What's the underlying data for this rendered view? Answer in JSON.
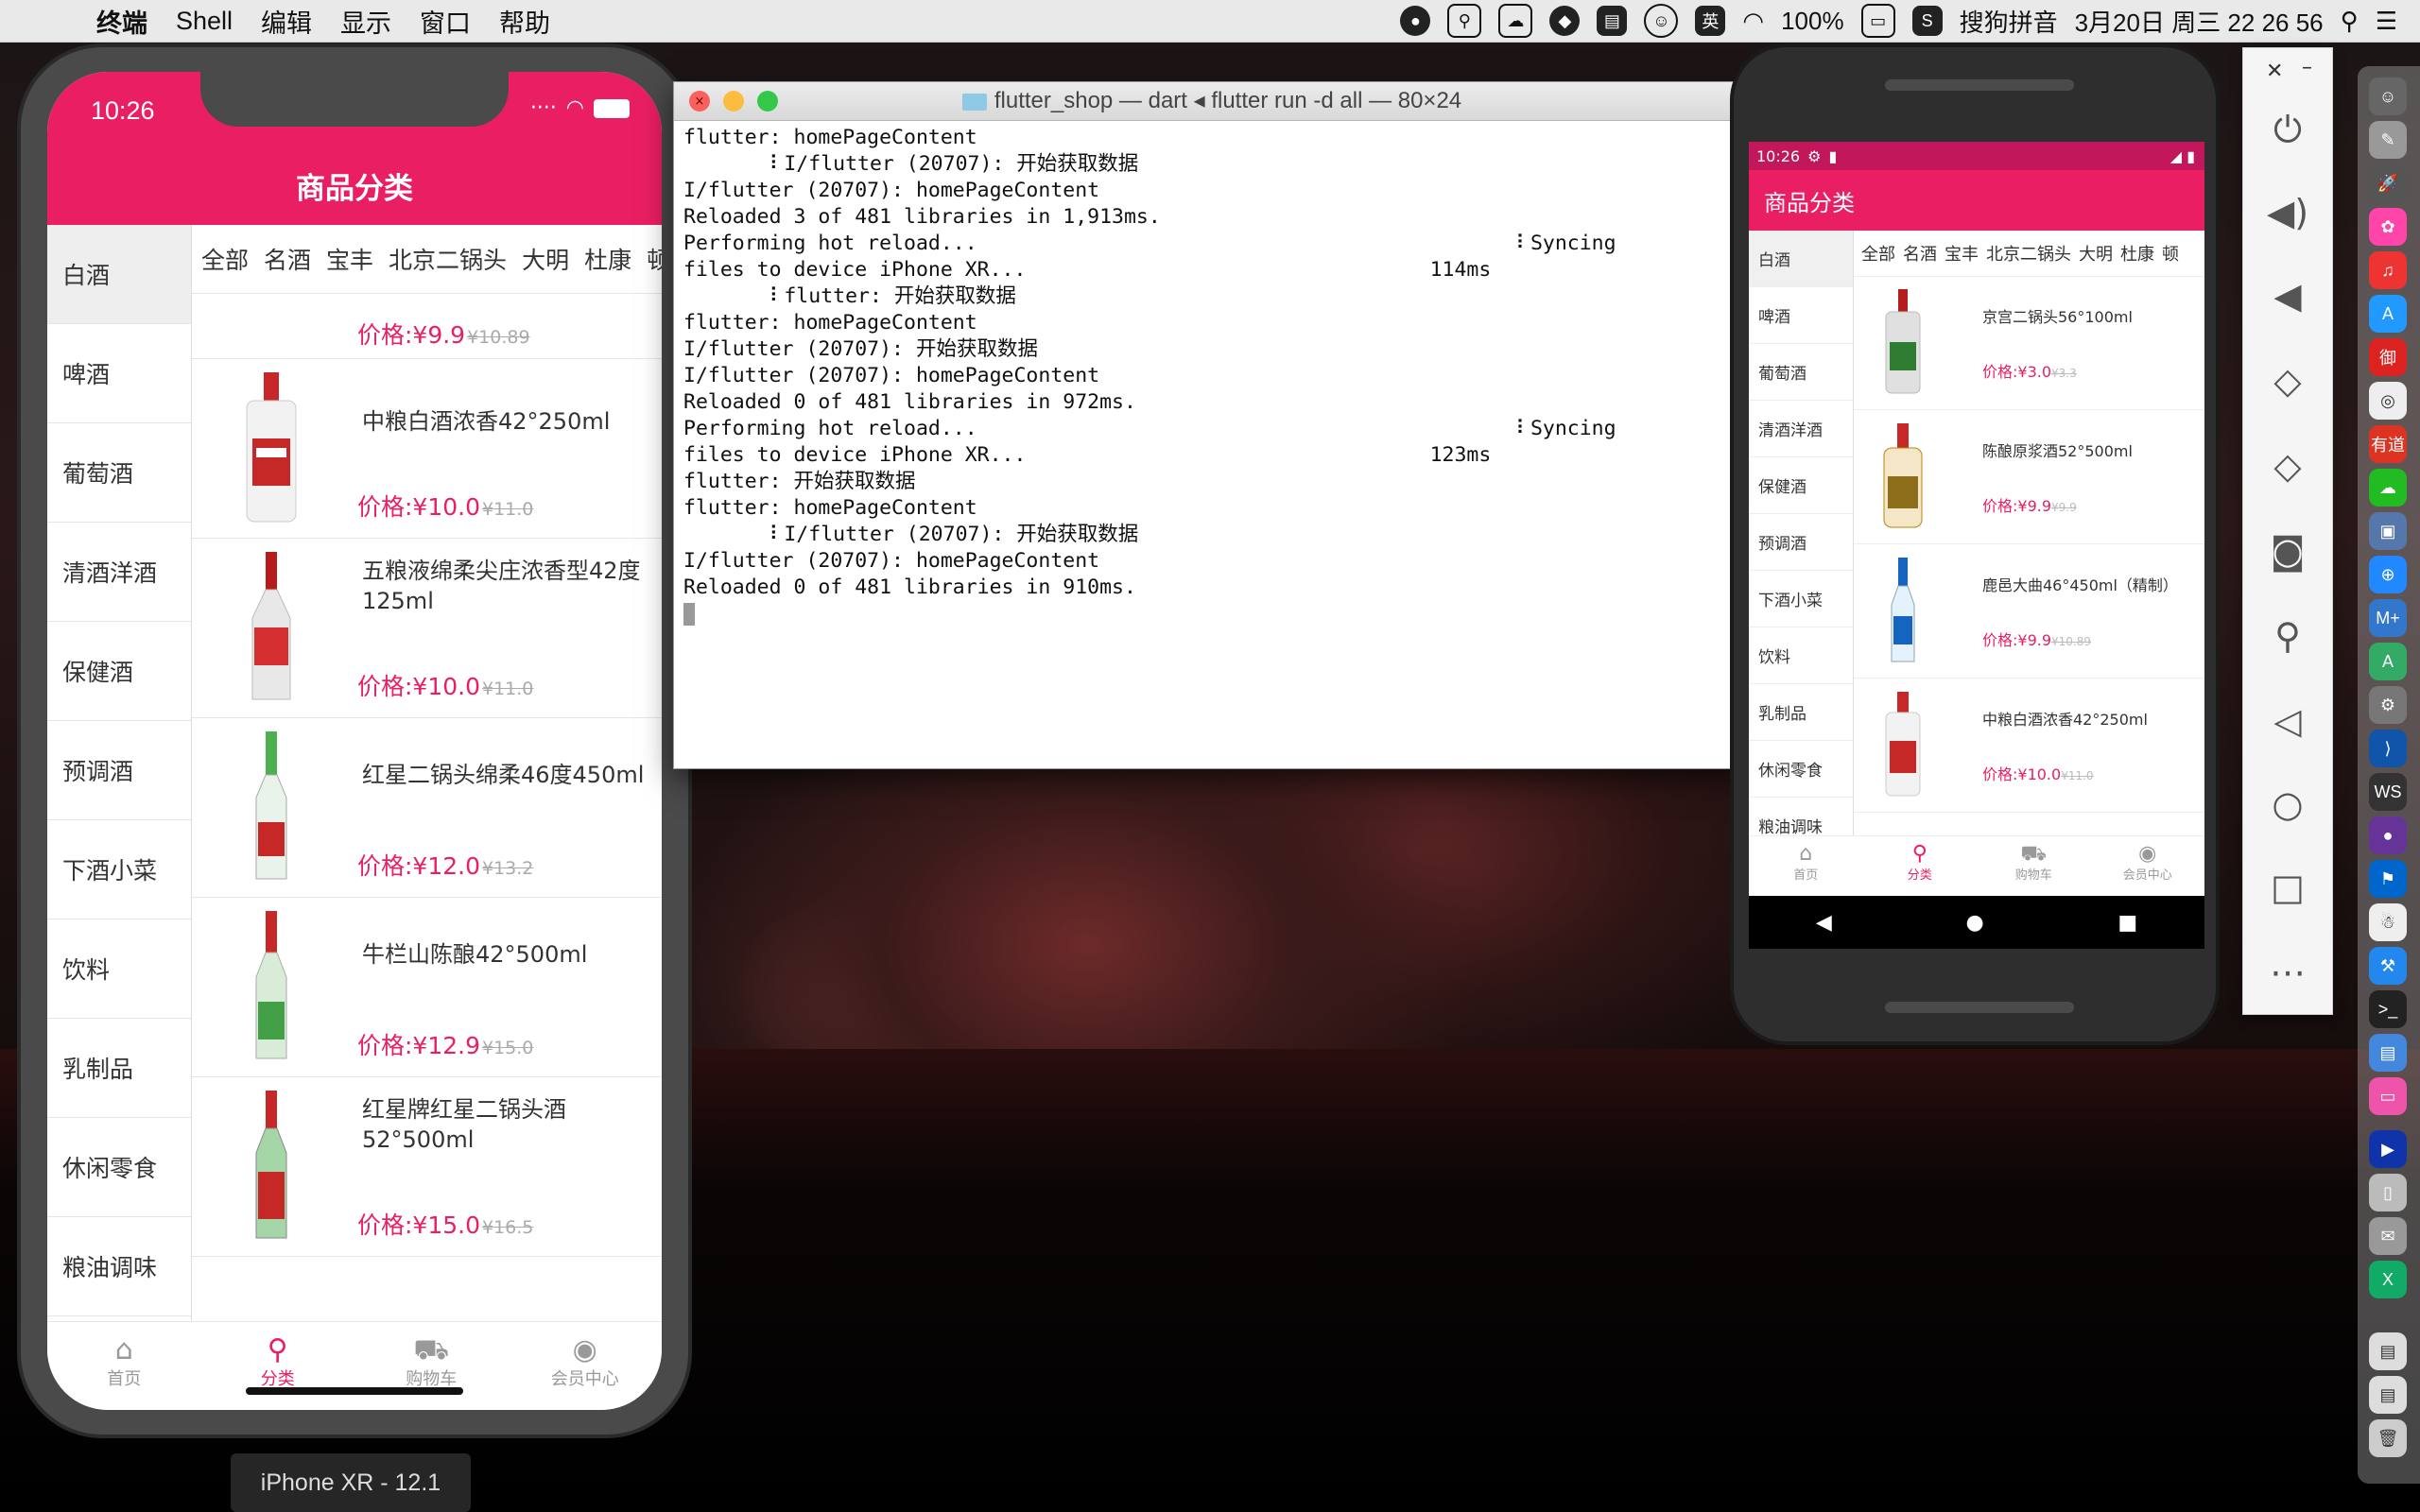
{
  "menubar": {
    "app": "终端",
    "items": [
      "Shell",
      "编辑",
      "显示",
      "窗口",
      "帮助"
    ],
    "status": {
      "battery": "100%",
      "ime": "搜狗拼音",
      "datetime": "3月20日 周三  22 26 56"
    }
  },
  "iphone": {
    "time": "10:26",
    "title": "商品分类",
    "categories": [
      "白酒",
      "啤酒",
      "葡萄酒",
      "清酒洋酒",
      "保健酒",
      "预调酒",
      "下酒小菜",
      "饮料",
      "乳制品",
      "休闲零食",
      "粮油调味"
    ],
    "subcategories": [
      "全部",
      "名酒",
      "宝丰",
      "北京二锅头",
      "大明",
      "杜康",
      "顿"
    ],
    "products": [
      {
        "name": "",
        "price": "价格:¥9.9",
        "old": "¥10.89"
      },
      {
        "name": "中粮白酒浓香42°250ml",
        "price": "价格:¥10.0",
        "old": "¥11.0"
      },
      {
        "name": "五粮液绵柔尖庄浓香型42度125ml",
        "price": "价格:¥10.0",
        "old": "¥11.0"
      },
      {
        "name": "红星二锅头绵柔46度450ml",
        "price": "价格:¥12.0",
        "old": "¥13.2"
      },
      {
        "name": "牛栏山陈酿42°500ml",
        "price": "价格:¥12.9",
        "old": "¥15.0"
      },
      {
        "name": "红星牌红星二锅头酒52°500ml",
        "price": "价格:¥15.0",
        "old": "¥16.5"
      }
    ],
    "tabs": [
      {
        "label": "首页",
        "icon": "⌂"
      },
      {
        "label": "分类",
        "icon": "⚲"
      },
      {
        "label": "购物车",
        "icon": "⛟"
      },
      {
        "label": "会员中心",
        "icon": "◉"
      }
    ],
    "device_label": "iPhone XR - 12.1"
  },
  "terminal": {
    "title": "flutter_shop — dart ◂ flutter run -d all — 80×24",
    "lines": [
      "flutter: homePageContent",
      "       ⠇I/flutter (20707): 开始获取数据",
      "I/flutter (20707): homePageContent",
      "",
      "Reloaded 3 of 481 libraries in 1,913ms.",
      "",
      "Performing hot reload...                                            ⠇Syncing",
      "files to device iPhone XR...                                 114ms",
      "       ⠇flutter: 开始获取数据",
      "flutter: homePageContent",
      "I/flutter (20707): 开始获取数据",
      "I/flutter (20707): homePageContent",
      "",
      "Reloaded 0 of 481 libraries in 972ms.",
      "",
      "Performing hot reload...                                            ⠇Syncing",
      "files to device iPhone XR...                                 123ms",
      "flutter: 开始获取数据",
      "flutter: homePageContent",
      "       ⠇I/flutter (20707): 开始获取数据",
      "I/flutter (20707): homePageContent",
      "",
      "Reloaded 0 of 481 libraries in 910ms."
    ]
  },
  "android": {
    "time": "10:26",
    "title": "商品分类",
    "categories": [
      "白酒",
      "啤酒",
      "葡萄酒",
      "清酒洋酒",
      "保健酒",
      "预调酒",
      "下酒小菜",
      "饮料",
      "乳制品",
      "休闲零食",
      "粮油调味"
    ],
    "subcategories": [
      "全部",
      "名酒",
      "宝丰",
      "北京二锅头",
      "大明",
      "杜康",
      "顿"
    ],
    "products": [
      {
        "name": "京宫二锅头56°100ml",
        "price": "价格:¥3.0",
        "old": "¥3.3"
      },
      {
        "name": "陈酿原浆酒52°500ml",
        "price": "价格:¥9.9",
        "old": "¥9.9"
      },
      {
        "name": "鹿邑大曲46°450ml（精制）",
        "price": "价格:¥9.9",
        "old": "¥10.89"
      },
      {
        "name": "中粮白酒浓香42°250ml",
        "price": "价格:¥10.0",
        "old": "¥11.0"
      }
    ],
    "tabs": [
      {
        "label": "首页",
        "icon": "⌂"
      },
      {
        "label": "分类",
        "icon": "⚲"
      },
      {
        "label": "购物车",
        "icon": "⛟"
      },
      {
        "label": "会员中心",
        "icon": "◉"
      }
    ],
    "nav": [
      "◀",
      "●",
      "■"
    ]
  },
  "emulator_toolbar": {
    "buttons": [
      "power-icon",
      "volume-up-icon",
      "volume-down-icon",
      "rotate-left-icon",
      "rotate-right-icon",
      "camera-icon",
      "zoom-icon",
      "back-icon",
      "home-icon",
      "overview-icon",
      "more-icon"
    ]
  },
  "colors": {
    "accent": "#e91e63",
    "android_status": "#c2185b"
  }
}
